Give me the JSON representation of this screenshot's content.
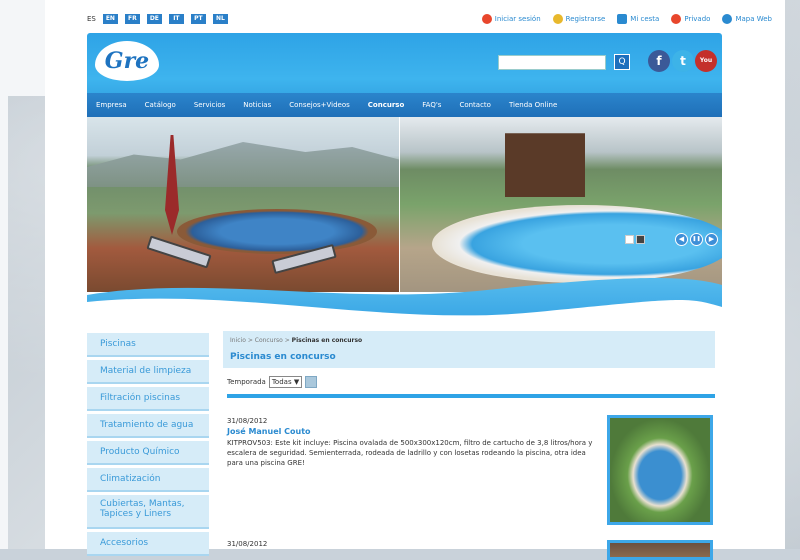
{
  "languages": {
    "current": "ES",
    "flags": [
      "EN",
      "FR",
      "DE",
      "IT",
      "PT",
      "NL"
    ]
  },
  "utility_links": [
    {
      "label": "Iniciar sesión",
      "icon": "power-icon",
      "color": "#e8462c"
    },
    {
      "label": "Registrarse",
      "icon": "user-icon",
      "color": "#e8b82c"
    },
    {
      "label": "Mi cesta",
      "icon": "cart-icon",
      "color": "#2a8ad0"
    },
    {
      "label": "Privado",
      "icon": "lock-icon",
      "color": "#e8462c"
    },
    {
      "label": "Mapa Web",
      "icon": "globe-icon",
      "color": "#2a8ad0"
    }
  ],
  "header": {
    "logo_text": "Gre",
    "search_button": "Q",
    "social": [
      {
        "name": "facebook-icon",
        "glyph": "f",
        "color": "#3b5998"
      },
      {
        "name": "twitter-icon",
        "glyph": "t",
        "color": "#3db3e8"
      },
      {
        "name": "youtube-icon",
        "glyph": "You",
        "color": "#c4302b"
      }
    ]
  },
  "nav": [
    "Empresa",
    "Catálogo",
    "Servicios",
    "Noticias",
    "Consejos+Videos",
    "Concurso",
    "FAQ's",
    "Contacto",
    "Tienda Online"
  ],
  "nav_active": "Concurso",
  "slider": {
    "prev": "◀",
    "pause": "❚❚",
    "next": "▶"
  },
  "sidebar": [
    "Piscinas",
    "Material de limpieza",
    "Filtración piscinas",
    "Tratamiento de agua",
    "Producto Químico",
    "Climatización",
    "Cubiertas, Mantas, Tapices y Liners",
    "Accesorios"
  ],
  "breadcrumb": {
    "home": "Inicio",
    "sep": ">",
    "level1": "Concurso",
    "current": "Piscinas en concurso"
  },
  "page_title": "Piscinas en concurso",
  "filter": {
    "label": "Temporada",
    "selected": "Todas"
  },
  "entries": [
    {
      "date": "31/08/2012",
      "name": "José Manuel Couto",
      "text": "KITPROV503: Este kit incluye: Piscina ovalada de 500x300x120cm, filtro de cartucho de 3,8 litros/hora y escalera de seguridad. Semienterrada, rodeada de ladrillo y con losetas rodeando la piscina, otra idea para una piscina GRE!"
    },
    {
      "date": "31/08/2012"
    }
  ]
}
